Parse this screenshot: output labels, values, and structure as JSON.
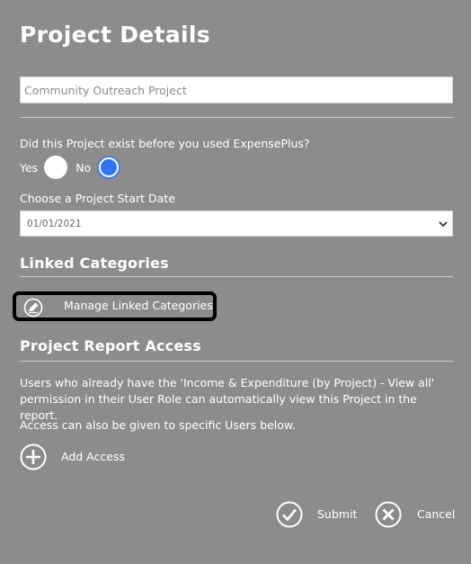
{
  "page": {
    "title": "Project Details",
    "project_name_value": "Community Outreach Project"
  },
  "existing": {
    "question": "Did this Project exist before you used ExpensePlus?",
    "yes_label": "Yes",
    "no_label": "No",
    "selected": "No"
  },
  "start_date": {
    "label": "Choose a Project Start Date",
    "value": "01/01/2021"
  },
  "linked_categories": {
    "heading": "Linked Categories",
    "manage_label": "Manage Linked Categories",
    "manage_icon": "edit-pencil-icon"
  },
  "report_access": {
    "heading": "Project Report Access",
    "info_1": "Users who already have the 'Income & Expenditure (by Project) - View all' permission in their User Role can automatically view this Project in the report.",
    "info_2": "Access can also be given to specific Users below.",
    "add_label": "Add Access",
    "add_icon": "plus-circle-icon"
  },
  "actions": {
    "submit_label": "Submit",
    "submit_icon": "check-circle-icon",
    "cancel_label": "Cancel",
    "cancel_icon": "x-circle-icon"
  },
  "colors": {
    "background": "#8c8c8c",
    "text": "#ffffff",
    "radio_selected": "#2f74f0",
    "highlight_border": "#000000"
  }
}
